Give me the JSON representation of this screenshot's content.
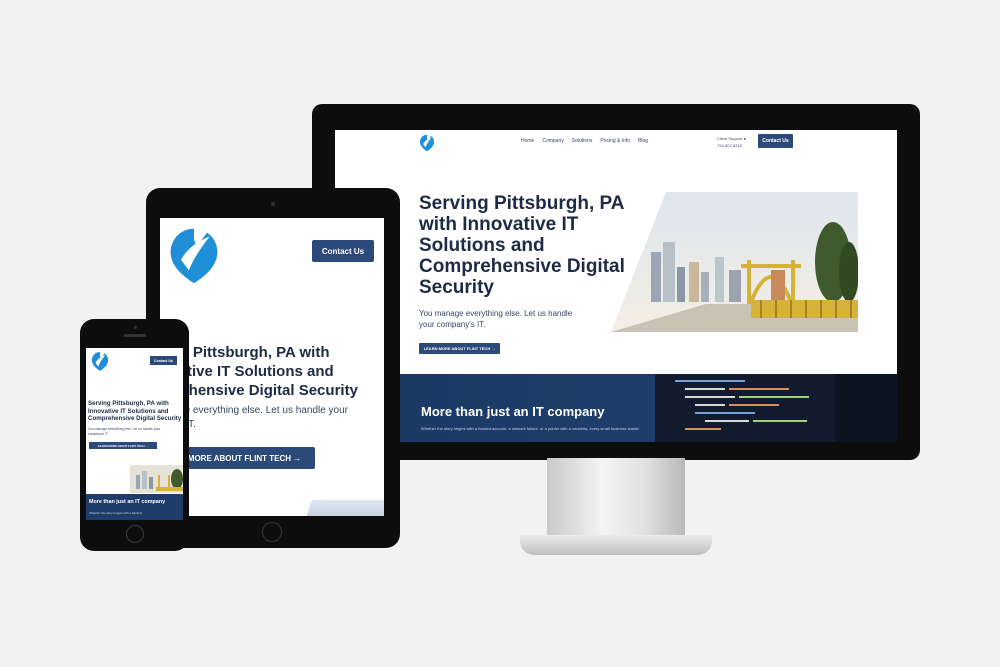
{
  "desktop": {
    "nav": {
      "items": [
        "Home",
        "Company",
        "Solutions",
        "Pricing & Info",
        "Blog"
      ],
      "support_label": "Client Support",
      "phone": "724-307-6315",
      "contact_button": "Contact Us"
    },
    "hero": {
      "title": "Serving Pittsburgh, PA with Innovative IT Solutions and Comprehensive Digital Security",
      "subtitle": "You manage everything else. Let us handle your company's IT.",
      "cta": "LEARN MORE ABOUT FLINT TECH →"
    },
    "band": {
      "title": "More than just an IT company",
      "text": "Whether the story begins with a hacked account, a network failure, or a printer with a vendetta, every small business leader"
    }
  },
  "tablet": {
    "contact_button": "Contact Us",
    "hero_lines": [
      "rving Pittsburgh, PA with",
      "novative IT Solutions and",
      "mprehensive Digital Security"
    ],
    "subtitle_lines": [
      "manage everything else. Let us handle your",
      "pany's IT."
    ],
    "cta": "RN MORE ABOUT FLINT TECH →"
  },
  "phone": {
    "contact_button": "Contact Us",
    "hero_title": "Serving Pittsburgh, PA with Innovative IT Solutions and Comprehensive Digital Security",
    "subtitle": "You manage everything else. Let us handle your company's IT.",
    "cta": "LEARN MORE ABOUT FLINT TECH →",
    "band_title": "More than just an IT company",
    "band_text": "Whether the story begins with a hacked"
  },
  "colors": {
    "brand_navy": "#2b4a7a",
    "band_blue": "#1f3d6a",
    "logo_blue": "#1f8fd8",
    "background": "#f2f2f2"
  },
  "icons": [
    "flint-tech-logo-icon",
    "user-icon"
  ]
}
